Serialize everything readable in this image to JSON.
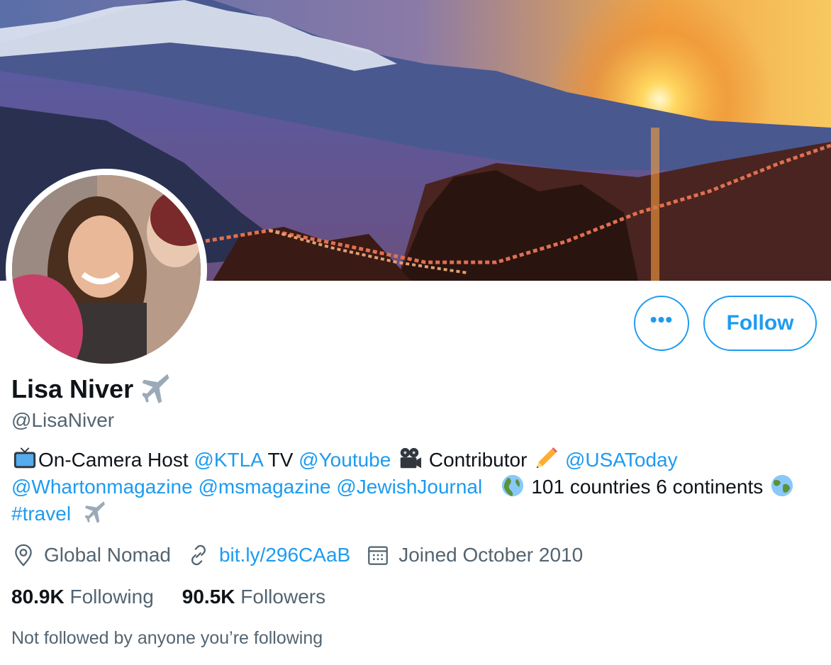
{
  "profile": {
    "display_name": "Lisa Niver",
    "handle": "@LisaNiver",
    "more_label": "•••",
    "follow_label": "Follow"
  },
  "bio": {
    "text1": "On-Camera Host ",
    "mention_ktla": "@KTLA",
    "text2": " TV ",
    "mention_youtube": "@Youtube",
    "text3": " Contributor ",
    "mention_usatoday": "@USAToday",
    "mention_wharton": "@Whartonmagazine",
    "mention_ms": "@msmagazine",
    "mention_jewish": "@JewishJournal",
    "text4": " 101 countries 6 continents ",
    "hashtag_travel": "#travel"
  },
  "meta": {
    "location": "Global Nomad",
    "website": "bit.ly/296CAaB",
    "joined": "Joined October 2010"
  },
  "stats": {
    "following_count": "80.9K",
    "following_label": "Following",
    "followers_count": "90.5K",
    "followers_label": "Followers"
  },
  "not_followed": "Not followed by anyone you’re following",
  "colors": {
    "accent": "#1d9bf0",
    "secondary_text": "#536471",
    "primary_text": "#0f1419"
  },
  "icons": {
    "bio_tv": "tv-icon",
    "bio_camera": "movie-camera-icon",
    "bio_pencil": "pencil-icon",
    "bio_globe": "globe-icon",
    "plane": "airplane-icon",
    "location": "location-pin-icon",
    "link": "link-icon",
    "calendar": "calendar-icon"
  }
}
